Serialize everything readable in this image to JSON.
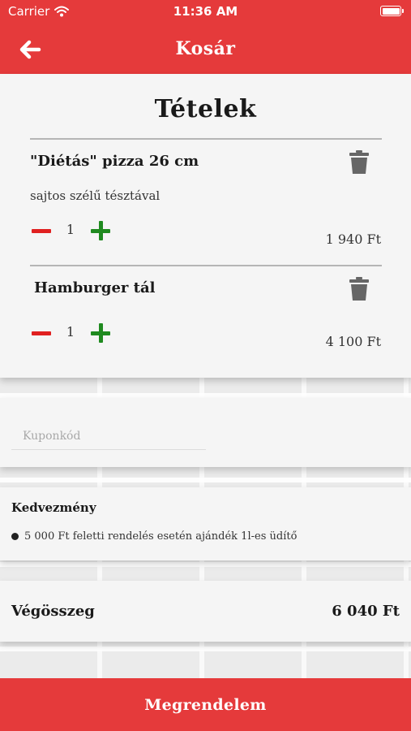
{
  "status_bar": {
    "carrier": "Carrier",
    "time": "11:36 AM"
  },
  "header": {
    "title": "Kosár",
    "back_icon": "arrow-left-icon"
  },
  "cart": {
    "heading": "Tételek",
    "items": [
      {
        "name": "\"Diétás\" pizza 26 cm",
        "description": "sajtos szélű tésztával",
        "quantity": "1",
        "price": "1 940 Ft"
      },
      {
        "name": "Hamburger tál",
        "description": "",
        "quantity": "1",
        "price": "4 100 Ft"
      }
    ]
  },
  "coupon": {
    "placeholder": "Kuponkód",
    "value": ""
  },
  "discount": {
    "title": "Kedvezmény",
    "items": [
      "5 000 Ft feletti rendelés esetén ajándék 1l-es üdítő"
    ]
  },
  "total": {
    "label": "Végösszeg",
    "value": "6 040 Ft"
  },
  "order_button": {
    "label": "Megrendelem"
  },
  "colors": {
    "brand_red": "#e53a3b",
    "minus_red": "#e02020",
    "plus_green": "#1f8a1f",
    "trash_gray": "#666666"
  }
}
